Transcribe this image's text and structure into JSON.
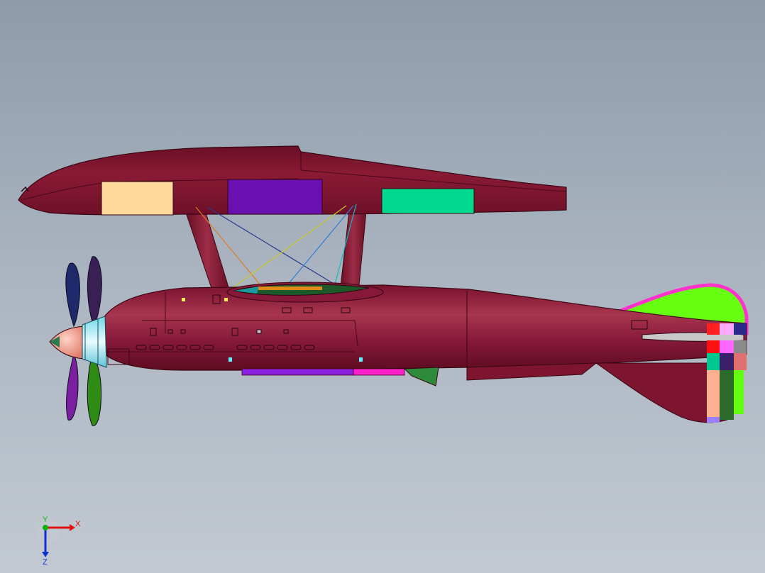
{
  "viewport": {
    "background_top": "#8e9bab",
    "background_bottom": "#c2c9d2"
  },
  "model": {
    "primary_color": "#7d1530",
    "highlight_color": "#a8354f",
    "components": [
      "upper-float",
      "float-struts",
      "bracing-wires",
      "fuselage",
      "cockpit",
      "propeller",
      "spinner",
      "tail-fin",
      "horizontal-stabilizer",
      "ventral-fin",
      "belly-panel",
      "wing-stub"
    ],
    "float_panels": [
      {
        "color": "#ffd79a"
      },
      {
        "color": "#6a0fb0"
      },
      {
        "color": "#00d98f"
      }
    ],
    "propeller_blade_colors": [
      "#1e2a6b",
      "#3a1f55",
      "#7b1fa0",
      "#2e8b14"
    ],
    "tail_fin_color": "#66ff11",
    "tail_fin_border": "#ff33cc"
  },
  "triad": {
    "x_label": "X",
    "y_label": "Y",
    "z_label": "Z",
    "x_color": "#e01010",
    "y_color": "#10b010",
    "z_color": "#1030d0"
  }
}
